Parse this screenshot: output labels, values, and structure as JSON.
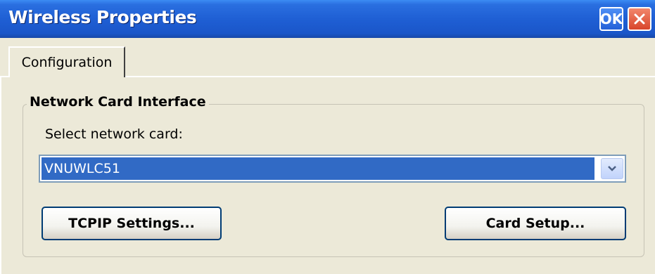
{
  "window": {
    "title": "Wireless Properties",
    "ok_label": "OK",
    "close_icon": "close-icon"
  },
  "tabs": [
    {
      "label": "Configuration",
      "active": true
    }
  ],
  "group": {
    "title": "Network Card Interface",
    "select_label": "Select network card:",
    "selected_card": "VNUWLC51",
    "dropdown_icon": "chevron-down-icon"
  },
  "buttons": {
    "tcpip_label": "TCPIP Settings...",
    "card_setup_label": "Card Setup..."
  },
  "colors": {
    "titlebar": "#1f5fd4",
    "selection": "#316ac5",
    "face": "#ece9d8"
  }
}
